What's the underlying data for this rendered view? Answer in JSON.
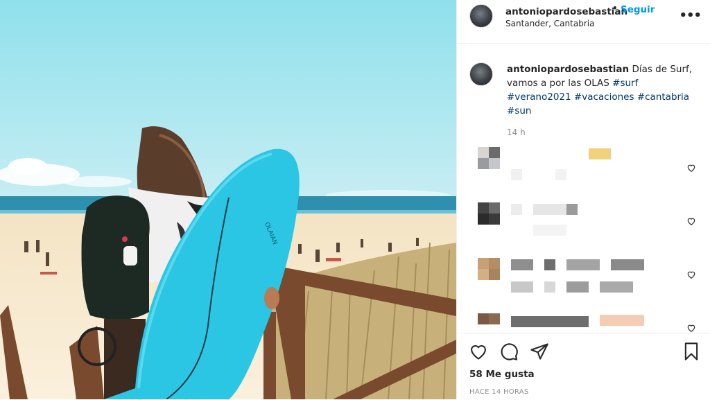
{
  "post": {
    "username": "antoniopardosebastian",
    "follow_label": "Seguir",
    "separator": "•",
    "location": "Santander, Cantabria",
    "more_label": "•••",
    "caption_text": "Días de Surf, vamos a por las OLAS",
    "hashtags": [
      "#surf",
      "#verano2021",
      "#vacaciones",
      "#cantabria",
      "#sun"
    ],
    "time": "14 h",
    "likes": "58 Me gusta",
    "ago": "HACE 14 HORAS",
    "surfboard_text": "OLAIAN"
  },
  "icons": {
    "like": "heart-icon",
    "comment": "comment-icon",
    "share": "paper-plane-icon",
    "save": "bookmark-icon",
    "comment_like": "heart-icon",
    "more": "more-icon"
  },
  "colors": {
    "link": "#0095f6",
    "hashtag": "#00376b",
    "muted": "#8e8e8e",
    "text": "#262626",
    "surfboard": "#2bc6e4"
  }
}
